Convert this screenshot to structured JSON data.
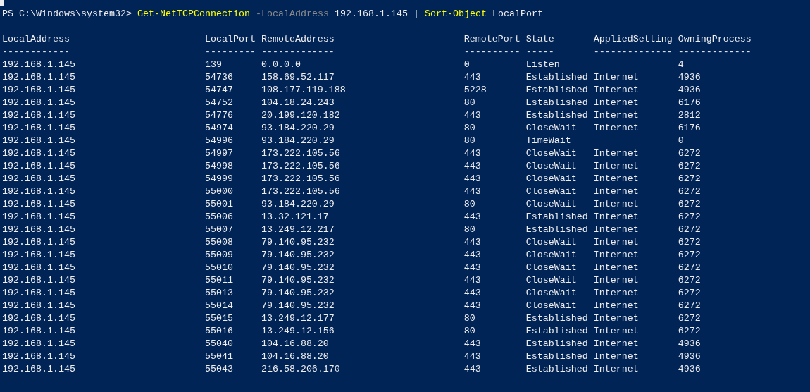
{
  "command_line": {
    "tokens": [
      {
        "kind": "prompt",
        "text": "PS C:\\Windows\\system32>"
      },
      {
        "kind": "cmdlet",
        "text": "Get-NetTCPConnection"
      },
      {
        "kind": "parameter",
        "text": "-LocalAddress"
      },
      {
        "kind": "argument",
        "text": "192.168.1.145"
      },
      {
        "kind": "operator",
        "text": "|"
      },
      {
        "kind": "cmdlet",
        "text": "Sort-Object"
      },
      {
        "kind": "argument",
        "text": "LocalPort"
      }
    ]
  },
  "table": {
    "columns": [
      "LocalAddress",
      "LocalPort",
      "RemoteAddress",
      "RemotePort",
      "State",
      "AppliedSetting",
      "OwningProcess"
    ],
    "underlines": [
      "------------",
      "---------",
      "-------------",
      "----------",
      "-----",
      "--------------",
      "-------------"
    ],
    "rows": [
      [
        "192.168.1.145",
        "139",
        "0.0.0.0",
        "0",
        "Listen",
        "",
        "4"
      ],
      [
        "192.168.1.145",
        "54736",
        "158.69.52.117",
        "443",
        "Established",
        "Internet",
        "4936"
      ],
      [
        "192.168.1.145",
        "54747",
        "108.177.119.188",
        "5228",
        "Established",
        "Internet",
        "4936"
      ],
      [
        "192.168.1.145",
        "54752",
        "104.18.24.243",
        "80",
        "Established",
        "Internet",
        "6176"
      ],
      [
        "192.168.1.145",
        "54776",
        "20.199.120.182",
        "443",
        "Established",
        "Internet",
        "2812"
      ],
      [
        "192.168.1.145",
        "54974",
        "93.184.220.29",
        "80",
        "CloseWait",
        "Internet",
        "6176"
      ],
      [
        "192.168.1.145",
        "54996",
        "93.184.220.29",
        "80",
        "TimeWait",
        "",
        "0"
      ],
      [
        "192.168.1.145",
        "54997",
        "173.222.105.56",
        "443",
        "CloseWait",
        "Internet",
        "6272"
      ],
      [
        "192.168.1.145",
        "54998",
        "173.222.105.56",
        "443",
        "CloseWait",
        "Internet",
        "6272"
      ],
      [
        "192.168.1.145",
        "54999",
        "173.222.105.56",
        "443",
        "CloseWait",
        "Internet",
        "6272"
      ],
      [
        "192.168.1.145",
        "55000",
        "173.222.105.56",
        "443",
        "CloseWait",
        "Internet",
        "6272"
      ],
      [
        "192.168.1.145",
        "55001",
        "93.184.220.29",
        "80",
        "CloseWait",
        "Internet",
        "6272"
      ],
      [
        "192.168.1.145",
        "55006",
        "13.32.121.17",
        "443",
        "Established",
        "Internet",
        "6272"
      ],
      [
        "192.168.1.145",
        "55007",
        "13.249.12.217",
        "80",
        "Established",
        "Internet",
        "6272"
      ],
      [
        "192.168.1.145",
        "55008",
        "79.140.95.232",
        "443",
        "CloseWait",
        "Internet",
        "6272"
      ],
      [
        "192.168.1.145",
        "55009",
        "79.140.95.232",
        "443",
        "CloseWait",
        "Internet",
        "6272"
      ],
      [
        "192.168.1.145",
        "55010",
        "79.140.95.232",
        "443",
        "CloseWait",
        "Internet",
        "6272"
      ],
      [
        "192.168.1.145",
        "55011",
        "79.140.95.232",
        "443",
        "CloseWait",
        "Internet",
        "6272"
      ],
      [
        "192.168.1.145",
        "55013",
        "79.140.95.232",
        "443",
        "CloseWait",
        "Internet",
        "6272"
      ],
      [
        "192.168.1.145",
        "55014",
        "79.140.95.232",
        "443",
        "CloseWait",
        "Internet",
        "6272"
      ],
      [
        "192.168.1.145",
        "55015",
        "13.249.12.177",
        "80",
        "Established",
        "Internet",
        "6272"
      ],
      [
        "192.168.1.145",
        "55016",
        "13.249.12.156",
        "80",
        "Established",
        "Internet",
        "6272"
      ],
      [
        "192.168.1.145",
        "55040",
        "104.16.88.20",
        "443",
        "Established",
        "Internet",
        "4936"
      ],
      [
        "192.168.1.145",
        "55041",
        "104.16.88.20",
        "443",
        "Established",
        "Internet",
        "4936"
      ],
      [
        "192.168.1.145",
        "55043",
        "216.58.206.170",
        "443",
        "Established",
        "Internet",
        "4936"
      ]
    ]
  }
}
